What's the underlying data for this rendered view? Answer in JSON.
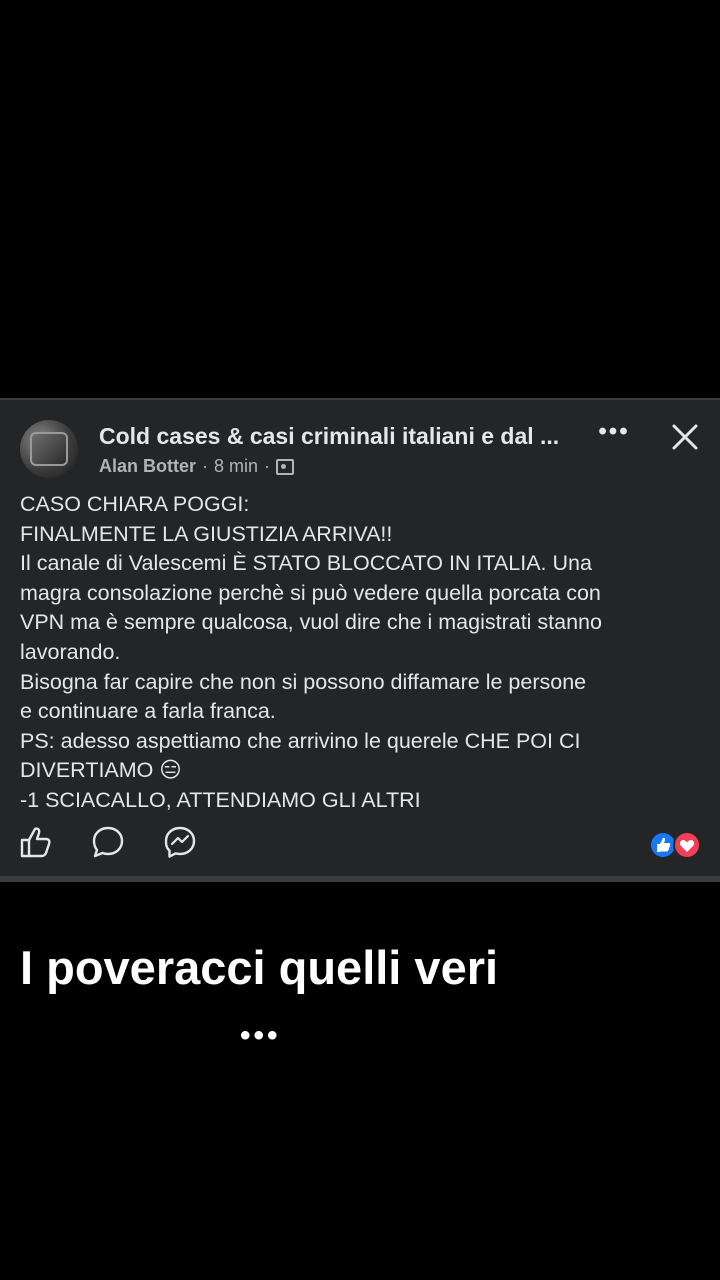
{
  "post": {
    "group_name": "Cold cases & casi criminali italiani e dal ...",
    "author": "Alan Botter",
    "separator": "·",
    "time": "8 min",
    "more_label": "•••",
    "text_lines": [
      "CASO CHIARA POGGI:",
      "FINALMENTE LA GIUSTIZIA ARRIVA!!",
      "Il canale di Valescemi È STATO BLOCCATO IN ITALIA. Una",
      "magra consolazione perchè si può vedere quella porcata con",
      "VPN ma è sempre qualcosa, vuol dire che i magistrati stanno",
      "lavorando.",
      "Bisogna far capire che non si possono diffamare le persone",
      "e continuare a farla franca.",
      "PS: adesso aspettiamo che arrivino le querele CHE POI CI",
      "DIVERTIAMO 😑",
      "-1 SCIACALLO, ATTENDIAMO GLI ALTRI"
    ],
    "icons": {
      "avatar": "group-avatar",
      "audience": "group-audience-icon",
      "more": "more-options-icon",
      "close": "close-icon",
      "like": "like-icon",
      "comment": "comment-icon",
      "share": "messenger-share-icon",
      "reaction_like": "like-reaction-icon",
      "reaction_love": "love-reaction-icon"
    },
    "colors": {
      "card_bg": "#242526",
      "text": "#e4e6eb",
      "secondary_text": "#b0b3b8",
      "like_blue": "#1877f2",
      "love_red": "#f33e58"
    }
  },
  "caption": {
    "text": "I poveracci quelli veri",
    "ellipsis": "•••"
  }
}
